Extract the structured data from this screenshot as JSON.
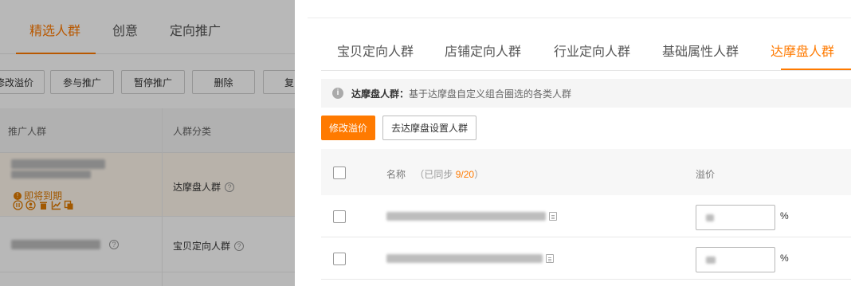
{
  "background_page": {
    "tabs": [
      {
        "label": "精选人群",
        "active": true
      },
      {
        "label": "创意",
        "active": false
      },
      {
        "label": "定向推广",
        "active": false
      }
    ],
    "toolbar_buttons": [
      "修改溢价",
      "参与推广",
      "暂停推广",
      "删除",
      "复"
    ],
    "table_headers": [
      "推广人群",
      "人群分类"
    ],
    "rows": [
      {
        "status": "即将到期",
        "category": "达摩盘人群"
      },
      {
        "category": "宝贝定向人群"
      }
    ]
  },
  "drawer": {
    "tabs": [
      {
        "label": "宝贝定向人群",
        "active": false
      },
      {
        "label": "店铺定向人群",
        "active": false
      },
      {
        "label": "行业定向人群",
        "active": false
      },
      {
        "label": "基础属性人群",
        "active": false
      },
      {
        "label": "达摩盘人群",
        "active": true
      }
    ],
    "notice": {
      "title": "达摩盘人群：",
      "text": "基于达摩盘自定义组合圈选的各类人群"
    },
    "buttons": {
      "modify_premium": "修改溢价",
      "go_setup": "去达摩盘设置人群"
    },
    "table": {
      "name_header": "名称",
      "sync_prefix": "（已同步",
      "sync_count": "9/20",
      "sync_suffix": "）",
      "premium_header": "溢价",
      "unit": "%"
    }
  },
  "colors": {
    "accent": "#ff7a00",
    "overlay": "rgba(0,0,0,0.28)"
  }
}
